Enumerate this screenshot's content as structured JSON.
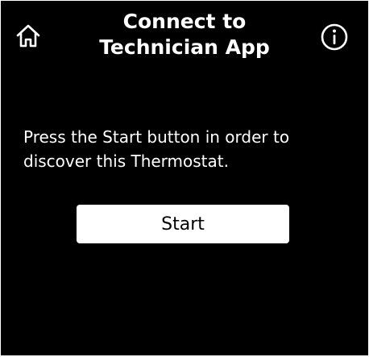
{
  "header": {
    "title_line1": "Connect to",
    "title_line2": "Technician App",
    "home_icon": "home-icon",
    "info_icon": "info-icon"
  },
  "message": {
    "line1": "Press the Start button in order to",
    "line2": "discover this Thermostat."
  },
  "start_button": {
    "label": "Start"
  },
  "colors": {
    "background": "#000000",
    "text": "#ffffff",
    "button_bg": "#ffffff",
    "button_text": "#000000"
  }
}
